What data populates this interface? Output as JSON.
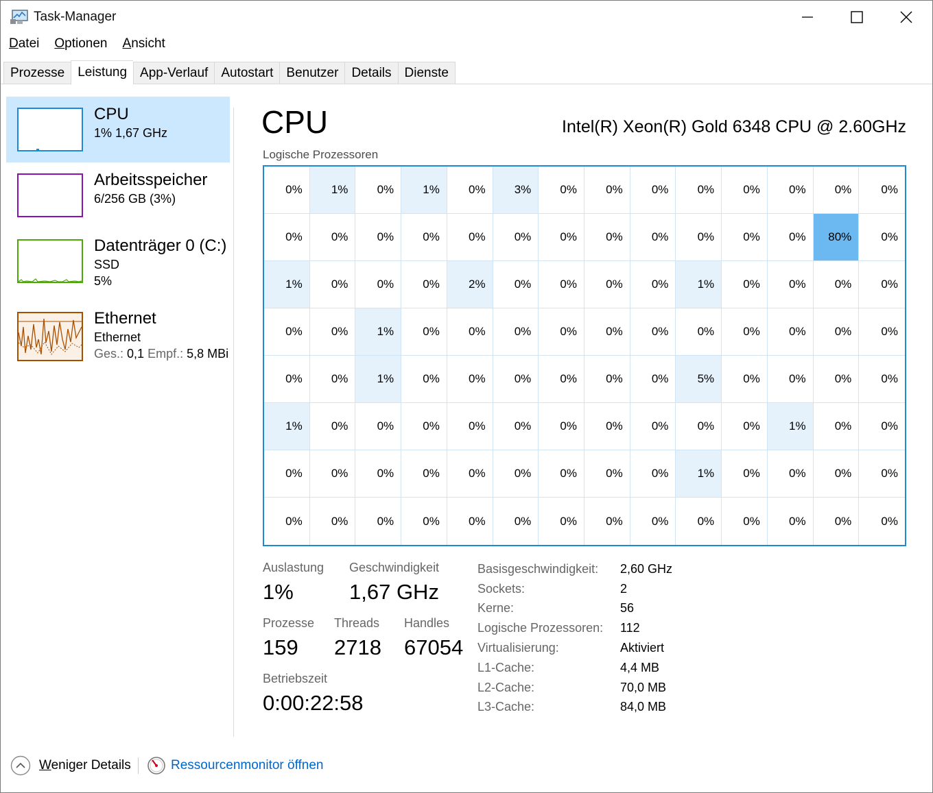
{
  "window": {
    "title": "Task-Manager"
  },
  "menu": {
    "items": [
      "Datei",
      "Optionen",
      "Ansicht"
    ]
  },
  "tabs": [
    "Prozesse",
    "Leistung",
    "App-Verlauf",
    "Autostart",
    "Benutzer",
    "Details",
    "Dienste"
  ],
  "active_tab": "Leistung",
  "sidebar": {
    "cpu": {
      "title": "CPU",
      "sub": "1% 1,67 GHz"
    },
    "memory": {
      "title": "Arbeitsspeicher",
      "sub": "6/256 GB (3%)"
    },
    "disk": {
      "title": "Datenträger 0 (C:)",
      "sub1": "SSD",
      "sub2": "5%"
    },
    "ethernet": {
      "title": "Ethernet",
      "sub1": "Ethernet",
      "send_label": "Ges.:",
      "send_value": "0,1",
      "recv_label": "Empf.:",
      "recv_value": "5,8 MBi"
    }
  },
  "main": {
    "title": "CPU",
    "model": "Intel(R) Xeon(R) Gold 6348 CPU @ 2.60GHz",
    "grid_label": "Logische Prozessoren"
  },
  "logical_processors": [
    [
      "0%",
      "1%",
      "0%",
      "1%",
      "0%",
      "3%",
      "0%",
      "0%",
      "0%",
      "0%",
      "0%",
      "0%",
      "0%",
      "0%"
    ],
    [
      "0%",
      "0%",
      "0%",
      "0%",
      "0%",
      "0%",
      "0%",
      "0%",
      "0%",
      "0%",
      "0%",
      "0%",
      "80%",
      "0%"
    ],
    [
      "1%",
      "0%",
      "0%",
      "0%",
      "2%",
      "0%",
      "0%",
      "0%",
      "0%",
      "1%",
      "0%",
      "0%",
      "0%",
      "0%"
    ],
    [
      "0%",
      "0%",
      "1%",
      "0%",
      "0%",
      "0%",
      "0%",
      "0%",
      "0%",
      "0%",
      "0%",
      "0%",
      "0%",
      "0%"
    ],
    [
      "0%",
      "0%",
      "1%",
      "0%",
      "0%",
      "0%",
      "0%",
      "0%",
      "0%",
      "5%",
      "0%",
      "0%",
      "0%",
      "0%"
    ],
    [
      "1%",
      "0%",
      "0%",
      "0%",
      "0%",
      "0%",
      "0%",
      "0%",
      "0%",
      "0%",
      "0%",
      "1%",
      "0%",
      "0%"
    ],
    [
      "0%",
      "0%",
      "0%",
      "0%",
      "0%",
      "0%",
      "0%",
      "0%",
      "0%",
      "1%",
      "0%",
      "0%",
      "0%",
      "0%"
    ],
    [
      "0%",
      "0%",
      "0%",
      "0%",
      "0%",
      "0%",
      "0%",
      "0%",
      "0%",
      "0%",
      "0%",
      "0%",
      "0%",
      "0%"
    ]
  ],
  "stats": {
    "utilization_label": "Auslastung",
    "utilization": "1%",
    "speed_label": "Geschwindigkeit",
    "speed": "1,67 GHz",
    "processes_label": "Prozesse",
    "processes": "159",
    "threads_label": "Threads",
    "threads": "2718",
    "handles_label": "Handles",
    "handles": "67054",
    "uptime_label": "Betriebszeit",
    "uptime": "0:00:22:58"
  },
  "info": [
    {
      "key": "Basisgeschwindigkeit:",
      "value": "2,60 GHz"
    },
    {
      "key": "Sockets:",
      "value": "2"
    },
    {
      "key": "Kerne:",
      "value": "56"
    },
    {
      "key": "Logische Prozessoren:",
      "value": "112"
    },
    {
      "key": "Virtualisierung:",
      "value": "Aktiviert"
    },
    {
      "key": "L1-Cache:",
      "value": "4,4 MB"
    },
    {
      "key": "L2-Cache:",
      "value": "70,0 MB"
    },
    {
      "key": "L3-Cache:",
      "value": "84,0 MB"
    }
  ],
  "footer": {
    "less_details": "Weniger Details",
    "resource_monitor": "Ressourcenmonitor öffnen"
  },
  "colors": {
    "cpu": "#1d89d4",
    "memory": "#8b12ae",
    "disk": "#4da60c",
    "ethernet": "#a74f01",
    "selected_bg": "#cce8ff",
    "link": "#0066cc"
  },
  "icons": {
    "app": "taskmanager-icon",
    "minimize": "minimize-icon",
    "maximize": "maximize-icon",
    "close": "close-icon",
    "less_details": "chevron-up-circle-icon",
    "resource_monitor": "resource-monitor-icon"
  }
}
